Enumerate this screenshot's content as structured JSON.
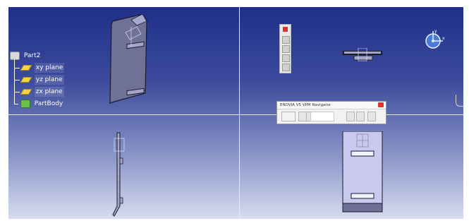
{
  "tree": {
    "root_label": "Part2",
    "items": [
      {
        "label": "xy plane",
        "icon": "plane-icon"
      },
      {
        "label": "yz plane",
        "icon": "plane-icon"
      },
      {
        "label": "zx plane",
        "icon": "plane-icon"
      },
      {
        "label": "PartBody",
        "icon": "partbody-icon"
      }
    ]
  },
  "enovia": {
    "title": "ENOVIA V5 VPM Navigator"
  },
  "compass": {
    "x_label": "x",
    "y_label": "y"
  }
}
